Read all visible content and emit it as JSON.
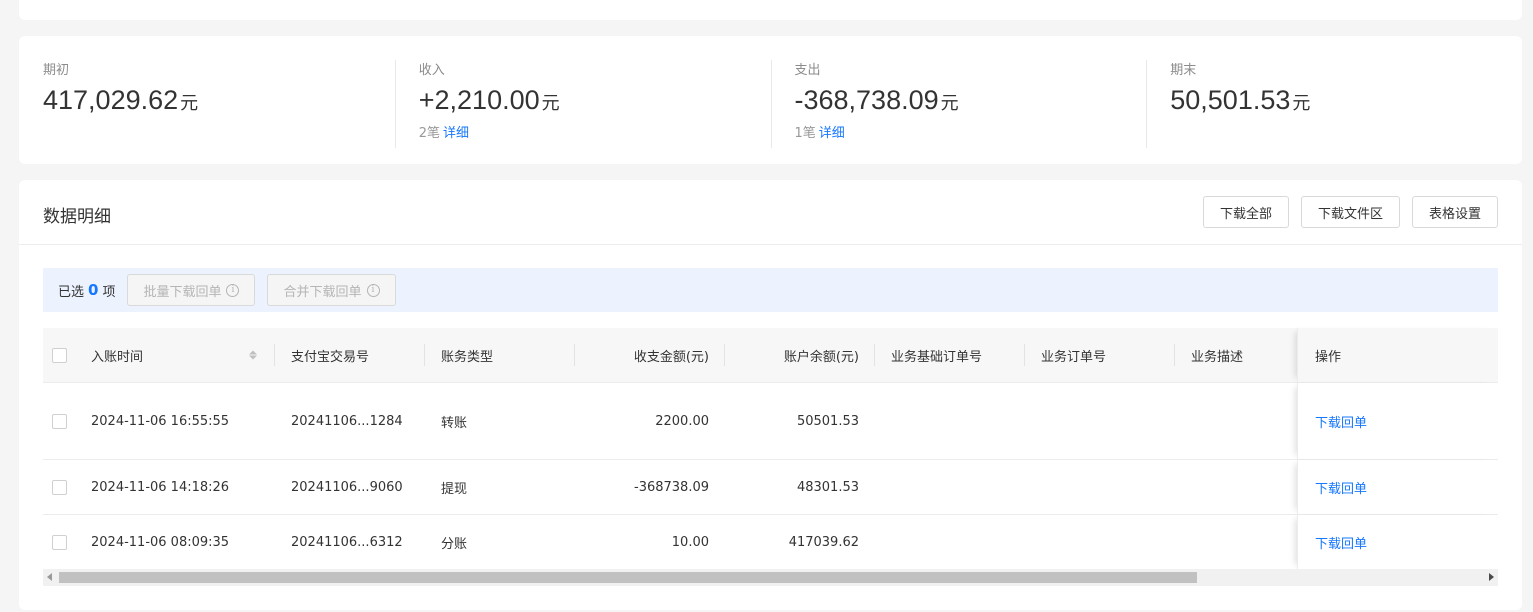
{
  "summary": [
    {
      "label": "期初",
      "value": "417,029.62",
      "unit": "元",
      "sub": "",
      "link": ""
    },
    {
      "label": "收入",
      "value": "+2,210.00",
      "unit": "元",
      "sub": "2笔",
      "link": "详细"
    },
    {
      "label": "支出",
      "value": "-368,738.09",
      "unit": "元",
      "sub": "1笔",
      "link": "详细"
    },
    {
      "label": "期末",
      "value": "50,501.53",
      "unit": "元",
      "sub": "",
      "link": ""
    }
  ],
  "detail": {
    "title": "数据明细",
    "buttons": {
      "download_all": "下载全部",
      "download_files": "下载文件区",
      "table_settings": "表格设置"
    }
  },
  "selection": {
    "prefix": "已选",
    "count": "0",
    "suffix": "项",
    "batch_download": "批量下载回单",
    "merge_download": "合并下载回单",
    "info_glyph": "i"
  },
  "table": {
    "columns": {
      "time": "入账时间",
      "trade_no": "支付宝交易号",
      "type": "账务类型",
      "amount": "收支金额(元)",
      "balance": "账户余额(元)",
      "base_order": "业务基础订单号",
      "order": "业务订单号",
      "desc": "业务描述",
      "op": "操作"
    },
    "rows": [
      {
        "time": "2024-11-06 16:55:55",
        "trade_no": "20241106...1284",
        "type": "转账",
        "amount": "2200.00",
        "balance": "50501.53",
        "op": "下载回单"
      },
      {
        "time": "2024-11-06 14:18:26",
        "trade_no": "20241106...9060",
        "type": "提现",
        "amount": "-368738.09",
        "balance": "48301.53",
        "op": "下载回单"
      },
      {
        "time": "2024-11-06 08:09:35",
        "trade_no": "20241106...6312",
        "type": "分账",
        "amount": "10.00",
        "balance": "417039.62",
        "op": "下载回单"
      }
    ]
  },
  "scrollbar": {
    "thumb_position": 0.0,
    "visible_fraction": 0.8
  }
}
